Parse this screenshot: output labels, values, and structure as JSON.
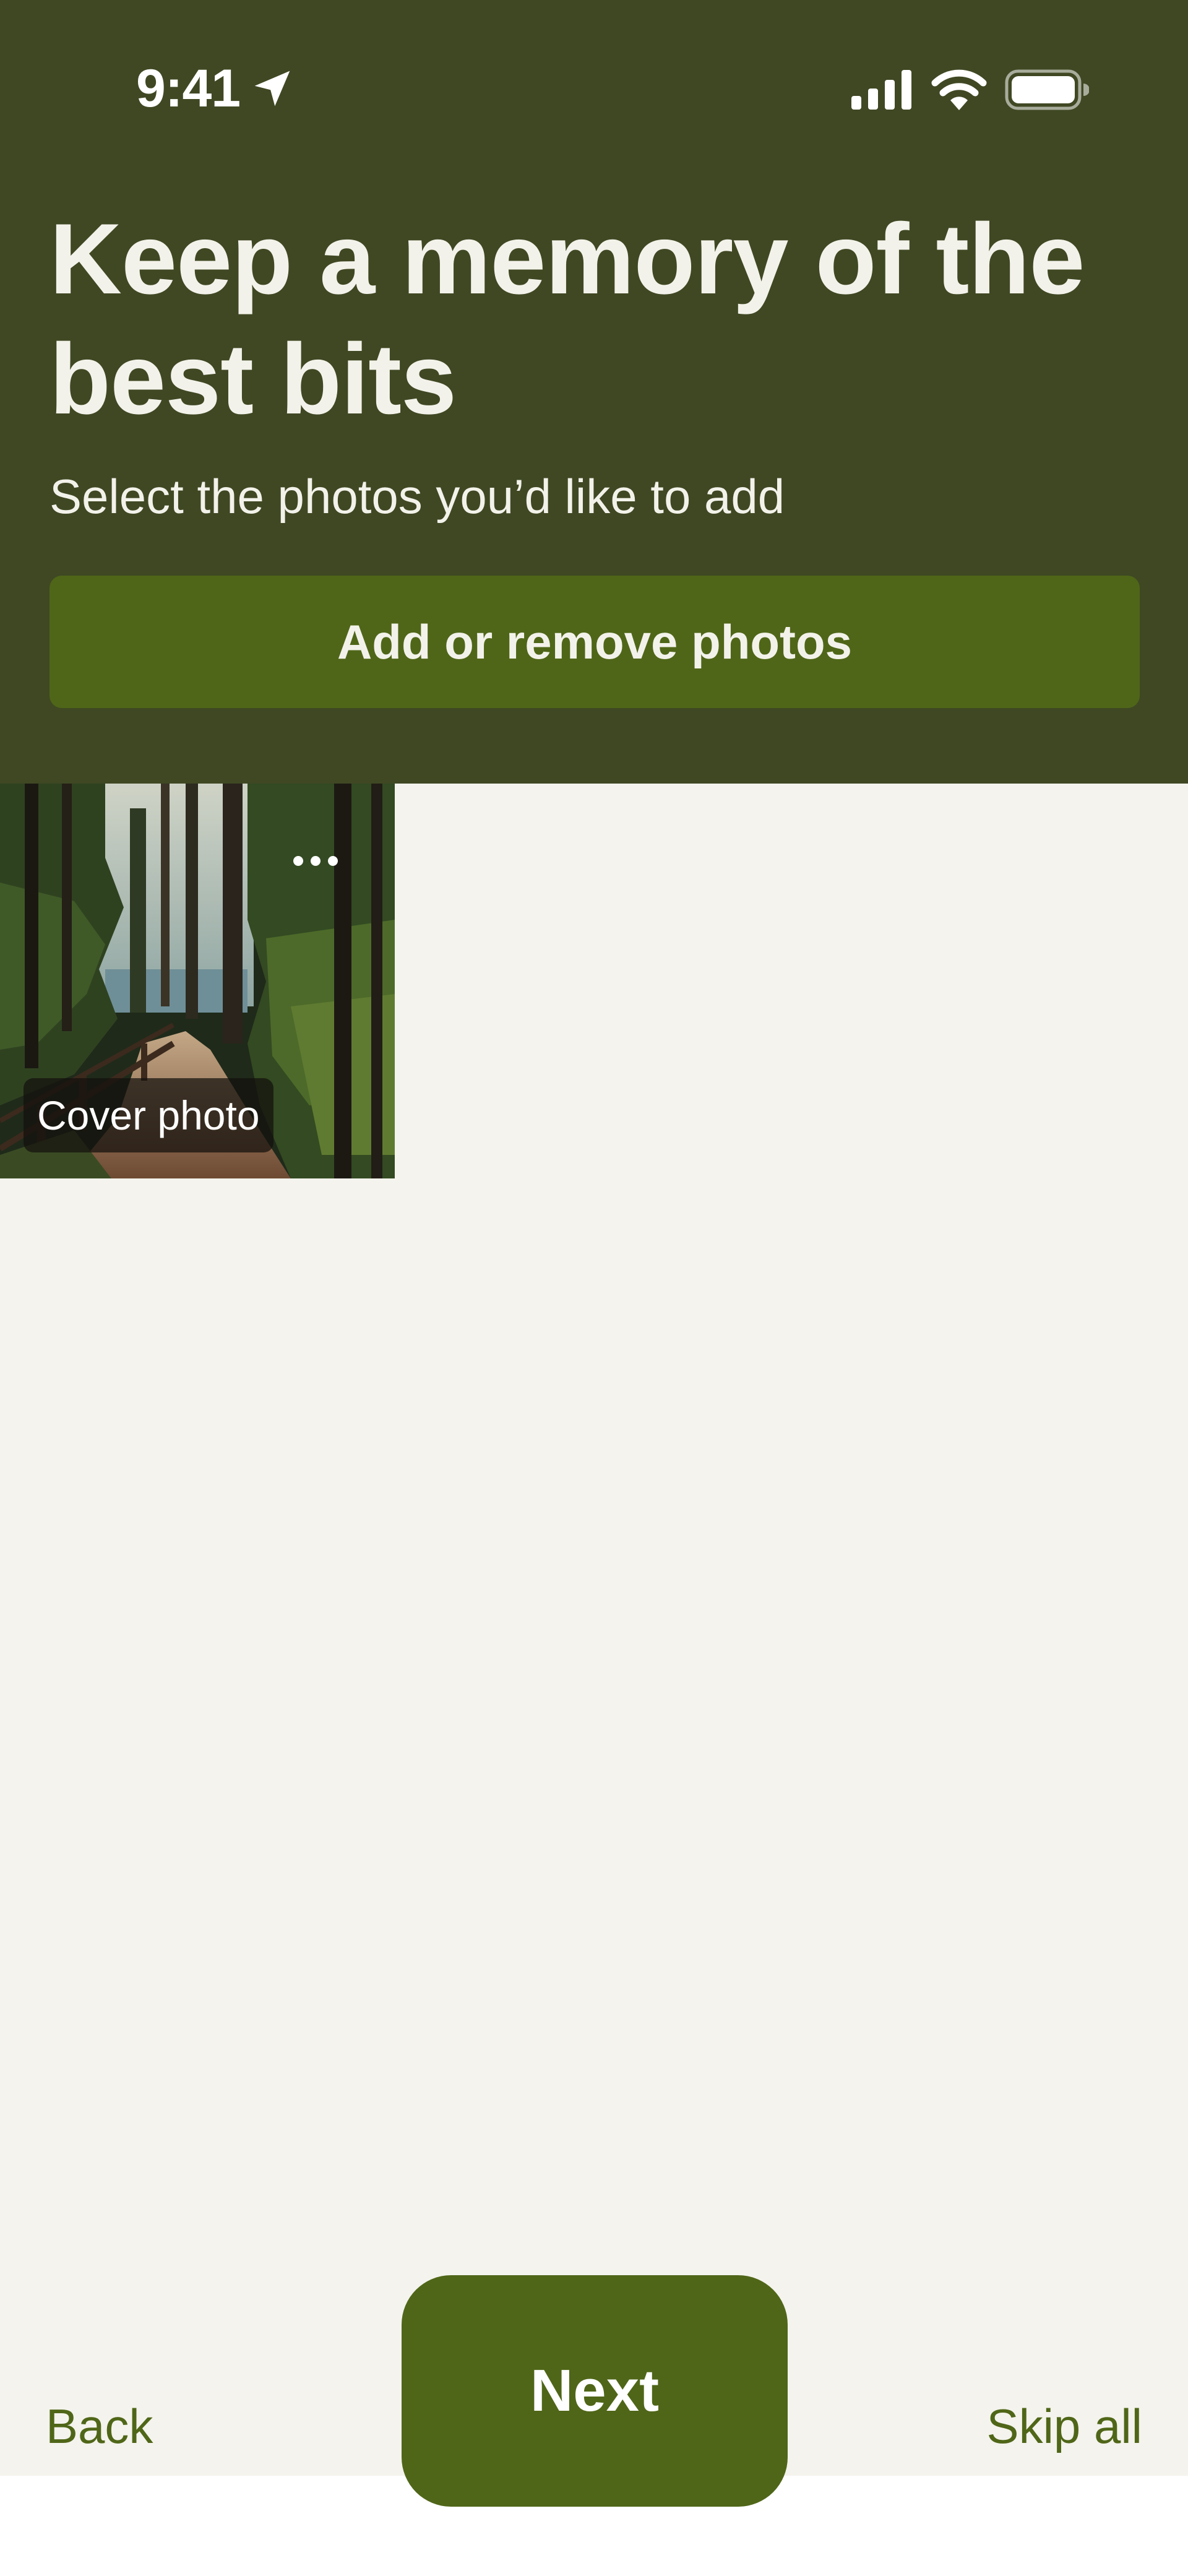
{
  "status_bar": {
    "time": "9:41",
    "icons": [
      "location-arrow-icon",
      "cellular-signal-icon",
      "wifi-icon",
      "battery-icon"
    ]
  },
  "header": {
    "title": "Keep a memory of the best bits",
    "subtitle": "Select the photos you’d like to add",
    "add_button_label": "Add or remove photos"
  },
  "photos": [
    {
      "badge": "Cover photo",
      "menu_icon": "more-horizontal-icon"
    }
  ],
  "bottom_nav": {
    "back_label": "Back",
    "next_label": "Next",
    "skip_label": "Skip all"
  },
  "colors": {
    "header_bg": "#3f4823",
    "accent": "#4f6618",
    "page_bg": "#f4f3ed",
    "header_text": "#f3f2ea"
  }
}
